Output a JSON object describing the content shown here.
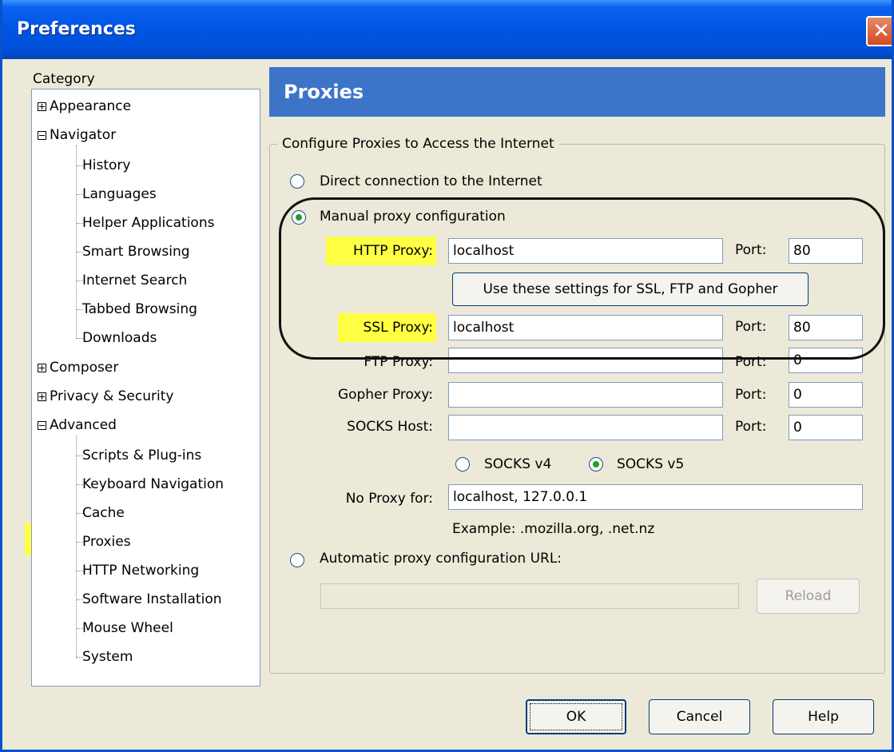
{
  "window": {
    "title": "Preferences",
    "close_glyph": "✕"
  },
  "category": {
    "label": "Category",
    "tree": {
      "appearance": "Appearance",
      "navigator": "Navigator",
      "history": "History",
      "languages": "Languages",
      "helper_apps": "Helper Applications",
      "smart_browsing": "Smart Browsing",
      "internet_search": "Internet Search",
      "tabbed_browsing": "Tabbed Browsing",
      "downloads": "Downloads",
      "composer": "Composer",
      "privacy_security": "Privacy & Security",
      "advanced": "Advanced",
      "scripts_plugins": "Scripts & Plug-ins",
      "keyboard_nav": "Keyboard Navigation",
      "cache": "Cache",
      "proxies": "Proxies",
      "http_networking": "HTTP Networking",
      "software_install": "Software Installation",
      "mouse_wheel": "Mouse Wheel",
      "system": "System"
    }
  },
  "panel": {
    "title": "Proxies",
    "group_title": "Configure Proxies to Access the Internet",
    "direct_label": "Direct connection to the Internet",
    "manual_label": "Manual proxy configuration",
    "http": {
      "label": "HTTP Proxy:",
      "value": "localhost",
      "port_label": "Port:",
      "port": "80"
    },
    "use_same_button": "Use these settings for SSL, FTP and Gopher",
    "ssl": {
      "label": "SSL Proxy:",
      "value": "localhost",
      "port_label": "Port:",
      "port": "80"
    },
    "ftp": {
      "label": "FTP Proxy:",
      "value": "",
      "port_label": "Port:",
      "port": "0"
    },
    "gopher": {
      "label": "Gopher Proxy:",
      "value": "",
      "port_label": "Port:",
      "port": "0"
    },
    "socks": {
      "label": "SOCKS Host:",
      "value": "",
      "port_label": "Port:",
      "port": "0"
    },
    "socks_v4": "SOCKS v4",
    "socks_v5": "SOCKS v5",
    "no_proxy": {
      "label": "No Proxy for:",
      "value": "localhost, 127.0.0.1"
    },
    "example": "Example: .mozilla.org, .net.nz",
    "auto_label": "Automatic proxy configuration URL:",
    "auto_value": "",
    "reload_button": "Reload"
  },
  "buttons": {
    "ok": "OK",
    "cancel": "Cancel",
    "help": "Help"
  },
  "colors": {
    "title_bar": "#0054e3",
    "header": "#3c74c8",
    "highlight": "#ffff44",
    "radio_dot": "#21a121"
  }
}
